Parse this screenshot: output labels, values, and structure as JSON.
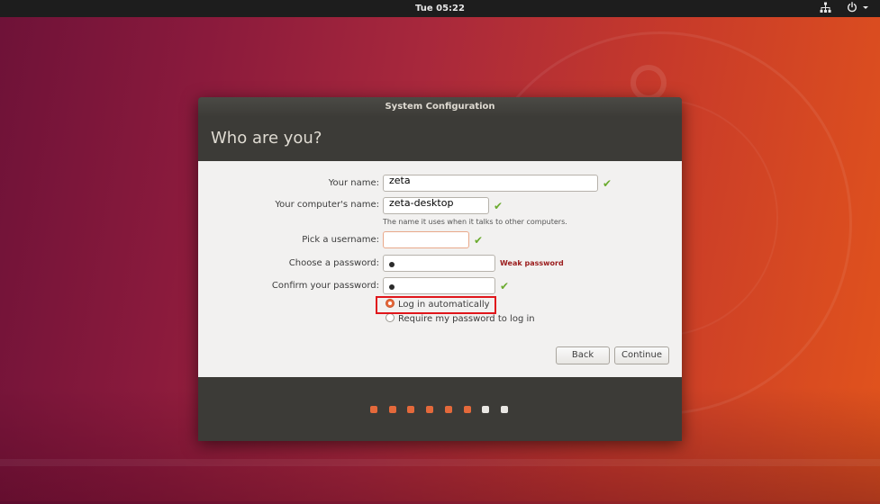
{
  "topbar": {
    "clock": "Tue 05:22",
    "icons": [
      "network-icon",
      "power-icon",
      "dropdown-arrow-icon"
    ]
  },
  "dialog": {
    "title": "System Configuration",
    "heading": "Who are you?",
    "form": {
      "name_label": "Your name:",
      "name_value": "zeta",
      "computer_label": "Your computer's name:",
      "computer_value": "zeta-desktop",
      "computer_hint": "The name it uses when it talks to other computers.",
      "username_label": "Pick a username:",
      "username_value": "",
      "password_label": "Choose a password:",
      "password_strength": "Weak password",
      "confirm_label": "Confirm your password:"
    },
    "login_options": [
      {
        "label": "Log in automatically",
        "selected": true
      },
      {
        "label": "Require my password to log in",
        "selected": false
      }
    ],
    "buttons": {
      "back": "Back",
      "continue": "Continue"
    },
    "progress": {
      "total": 8,
      "completed": 6
    }
  },
  "colors": {
    "accent": "#e4693b",
    "valid_check": "#6bab2f",
    "weak_password": "#9a1b1b",
    "highlight_box": "#e0161b"
  }
}
